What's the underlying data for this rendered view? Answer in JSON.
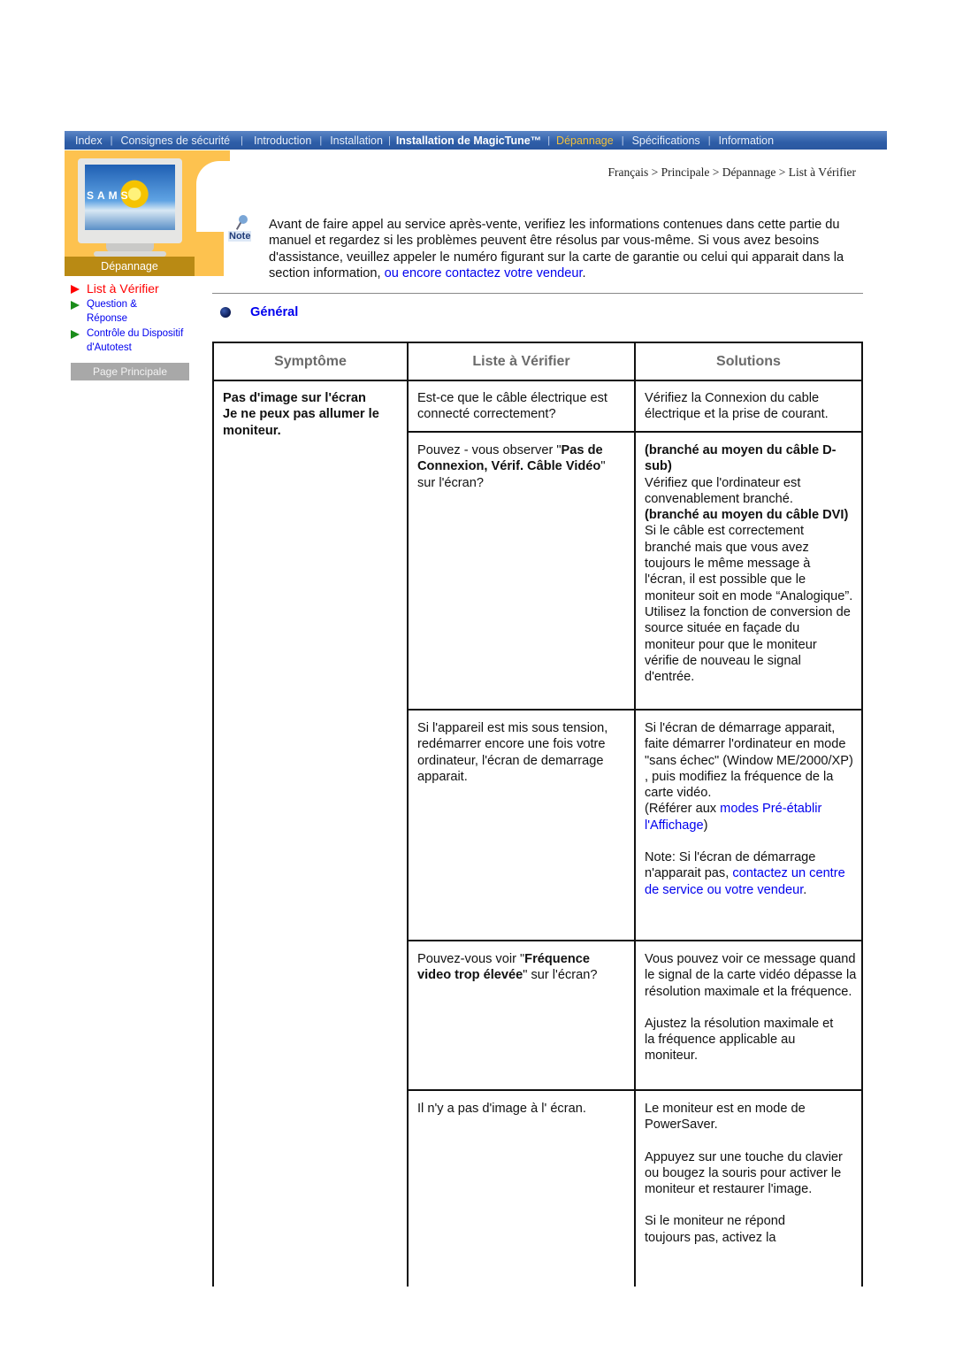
{
  "nav": {
    "items": [
      {
        "label": "Index",
        "active": false
      },
      {
        "label": "Consignes de sécurité",
        "active": false
      },
      {
        "label": "Introduction",
        "active": false
      },
      {
        "label": "Installation",
        "active": false
      },
      {
        "label": "Installation de MagicTune™",
        "active": false
      },
      {
        "label": "Dépannage",
        "active": true
      },
      {
        "label": "Spécifications",
        "active": false
      },
      {
        "label": "Information",
        "active": false
      }
    ],
    "active_color": "#f2c13c",
    "bar_color": "#2e5ea8"
  },
  "sidebar": {
    "monitor_brand": "SAMS",
    "section_label": "Dépannage",
    "items": [
      {
        "label": "List à Vérifier",
        "active": true
      },
      {
        "label": "Question & Réponse",
        "active": false
      },
      {
        "label": "Contrôle du Dispositif d'Autotest",
        "active": false
      }
    ],
    "home_button": "Page Principale"
  },
  "breadcrumb": "Français > Principale > Dépannage > List à Vérifier",
  "note": {
    "icon_label": "Note",
    "text": "Avant de faire appel au service après-vente, verifiez les informations contenues dans cette partie du manuel et regardez si les problèmes peuvent être résolus par vous-même. Si vous avez besoins d'assistance, veuillez appeler le numéro figurant sur la carte de garantie ou celui qui apparait dans la section information, ",
    "link": "ou encore contactez votre vendeur",
    "end": "."
  },
  "section": {
    "title": "Général"
  },
  "table": {
    "headers": [
      "Symptôme",
      "Liste à Vérifier",
      "Solutions"
    ],
    "symptom": {
      "line1": "Pas d'image sur l'écran",
      "line2": "Je ne peux pas allumer le moniteur."
    },
    "rows": [
      {
        "check": "Est-ce que le câble électrique est connecté correctement?",
        "solution": "Vérifiez la Connexion du cable électrique et la prise de courant."
      },
      {
        "check_pre": "Pouvez - vous observer \"",
        "check_bold": "Pas de Connexion, Vérif. Câble Vidéo",
        "check_post": "\" sur l'écran?",
        "sol_h1": "(branché au moyen du câble D-sub)",
        "sol_t1": "Vérifiez que l'ordinateur est convenablement branché.",
        "sol_h2": "(branché au moyen du câble DVI)",
        "sol_t2": "Si le câble est correctement branché mais que vous avez toujours le même message à l'écran, il est possible que le moniteur soit en mode “Analogique”. Utilisez la fonction de conversion de source située en façade du moniteur pour que le moniteur vérifie de nouveau le signal d'entrée."
      },
      {
        "check": "Si l'appareil est mis sous tension, redémarrer encore une fois votre ordinateur, l'écran de demarrage apparait.",
        "sol_t1": "Si l'écran de démarrage apparait, faite démarrer l'ordinateur en mode \"sans échec\" (Window ME/2000/XP) , puis modifiez la fréquence de la carte vidéo.",
        "sol_ref_pre": "(Référer aux ",
        "sol_ref_link": "modes Pré-établir l'Affichage",
        "sol_ref_post": ")",
        "sol_note_pre": "Note: Si l'écran de démarrage n'apparait pas, ",
        "sol_note_link": "contactez un centre de service ou votre vendeur",
        "sol_note_post": "."
      },
      {
        "check_pre": "Pouvez-vous voir \"",
        "check_bold": "Fréquence video trop élevée",
        "check_post": "\" sur l'écran?",
        "sol_t1": "Vous pouvez voir ce message quand le signal de la carte vidéo dépasse la résolution maximale et la fréquence.",
        "sol_t2": "Ajustez la résolution maximale et la fréquence applicable au moniteur."
      },
      {
        "check": "Il n'y a pas d'image à l' écran.",
        "sol_t1": "Le moniteur est en mode de PowerSaver.",
        "sol_t2": "Appuyez sur une touche du clavier ou bougez la souris pour activer le moniteur et restaurer l'image.",
        "sol_t3": "Si le moniteur ne répond toujours pas, activez la"
      }
    ]
  }
}
